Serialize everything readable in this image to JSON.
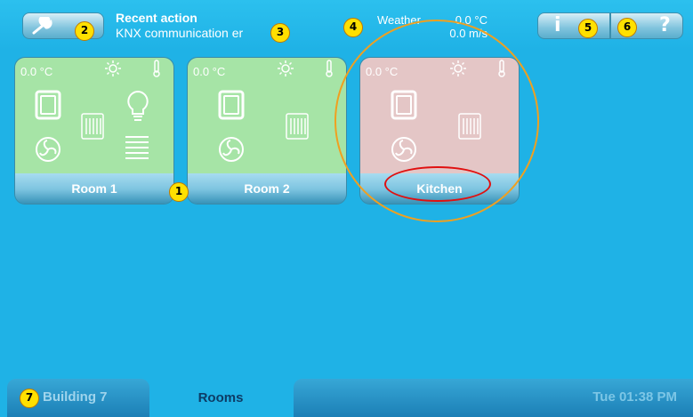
{
  "header": {
    "recent_title": "Recent action",
    "recent_message": "KNX communication er",
    "weather_label": "Weather",
    "weather_temp": "0.0 °C",
    "weather_wind": "0.0 m/s",
    "info_glyph": "i",
    "help_glyph": "?"
  },
  "rooms": [
    {
      "name": "Room 1",
      "temp": "0.0 °C",
      "state": "ok",
      "icons": [
        "sun-icon",
        "thermometer-icon",
        "window-icon",
        "radiator-icon",
        "lightbulb-icon",
        "fan-icon",
        "blinds-icon"
      ]
    },
    {
      "name": "Room 2",
      "temp": "0.0 °C",
      "state": "ok",
      "icons": [
        "sun-icon",
        "thermometer-icon",
        "window-icon",
        "radiator-icon",
        "fan-icon"
      ]
    },
    {
      "name": "Kitchen",
      "temp": "0.0 °C",
      "state": "alert",
      "icons": [
        "sun-icon",
        "thermometer-icon",
        "window-icon",
        "radiator-icon",
        "fan-icon"
      ]
    }
  ],
  "footer": {
    "building_tab": "Building 7",
    "rooms_tab": "Rooms",
    "datetime": "Tue 01:38 PM"
  },
  "markers": [
    "1",
    "2",
    "3",
    "4",
    "5",
    "6",
    "7"
  ],
  "colors": {
    "background": "#1fb2e6",
    "room_ok": "#a6e4a6",
    "room_alert": "#e4c6c6",
    "marker": "#ffe000",
    "highlight_orange": "#f0a020",
    "highlight_red": "#e01010"
  }
}
